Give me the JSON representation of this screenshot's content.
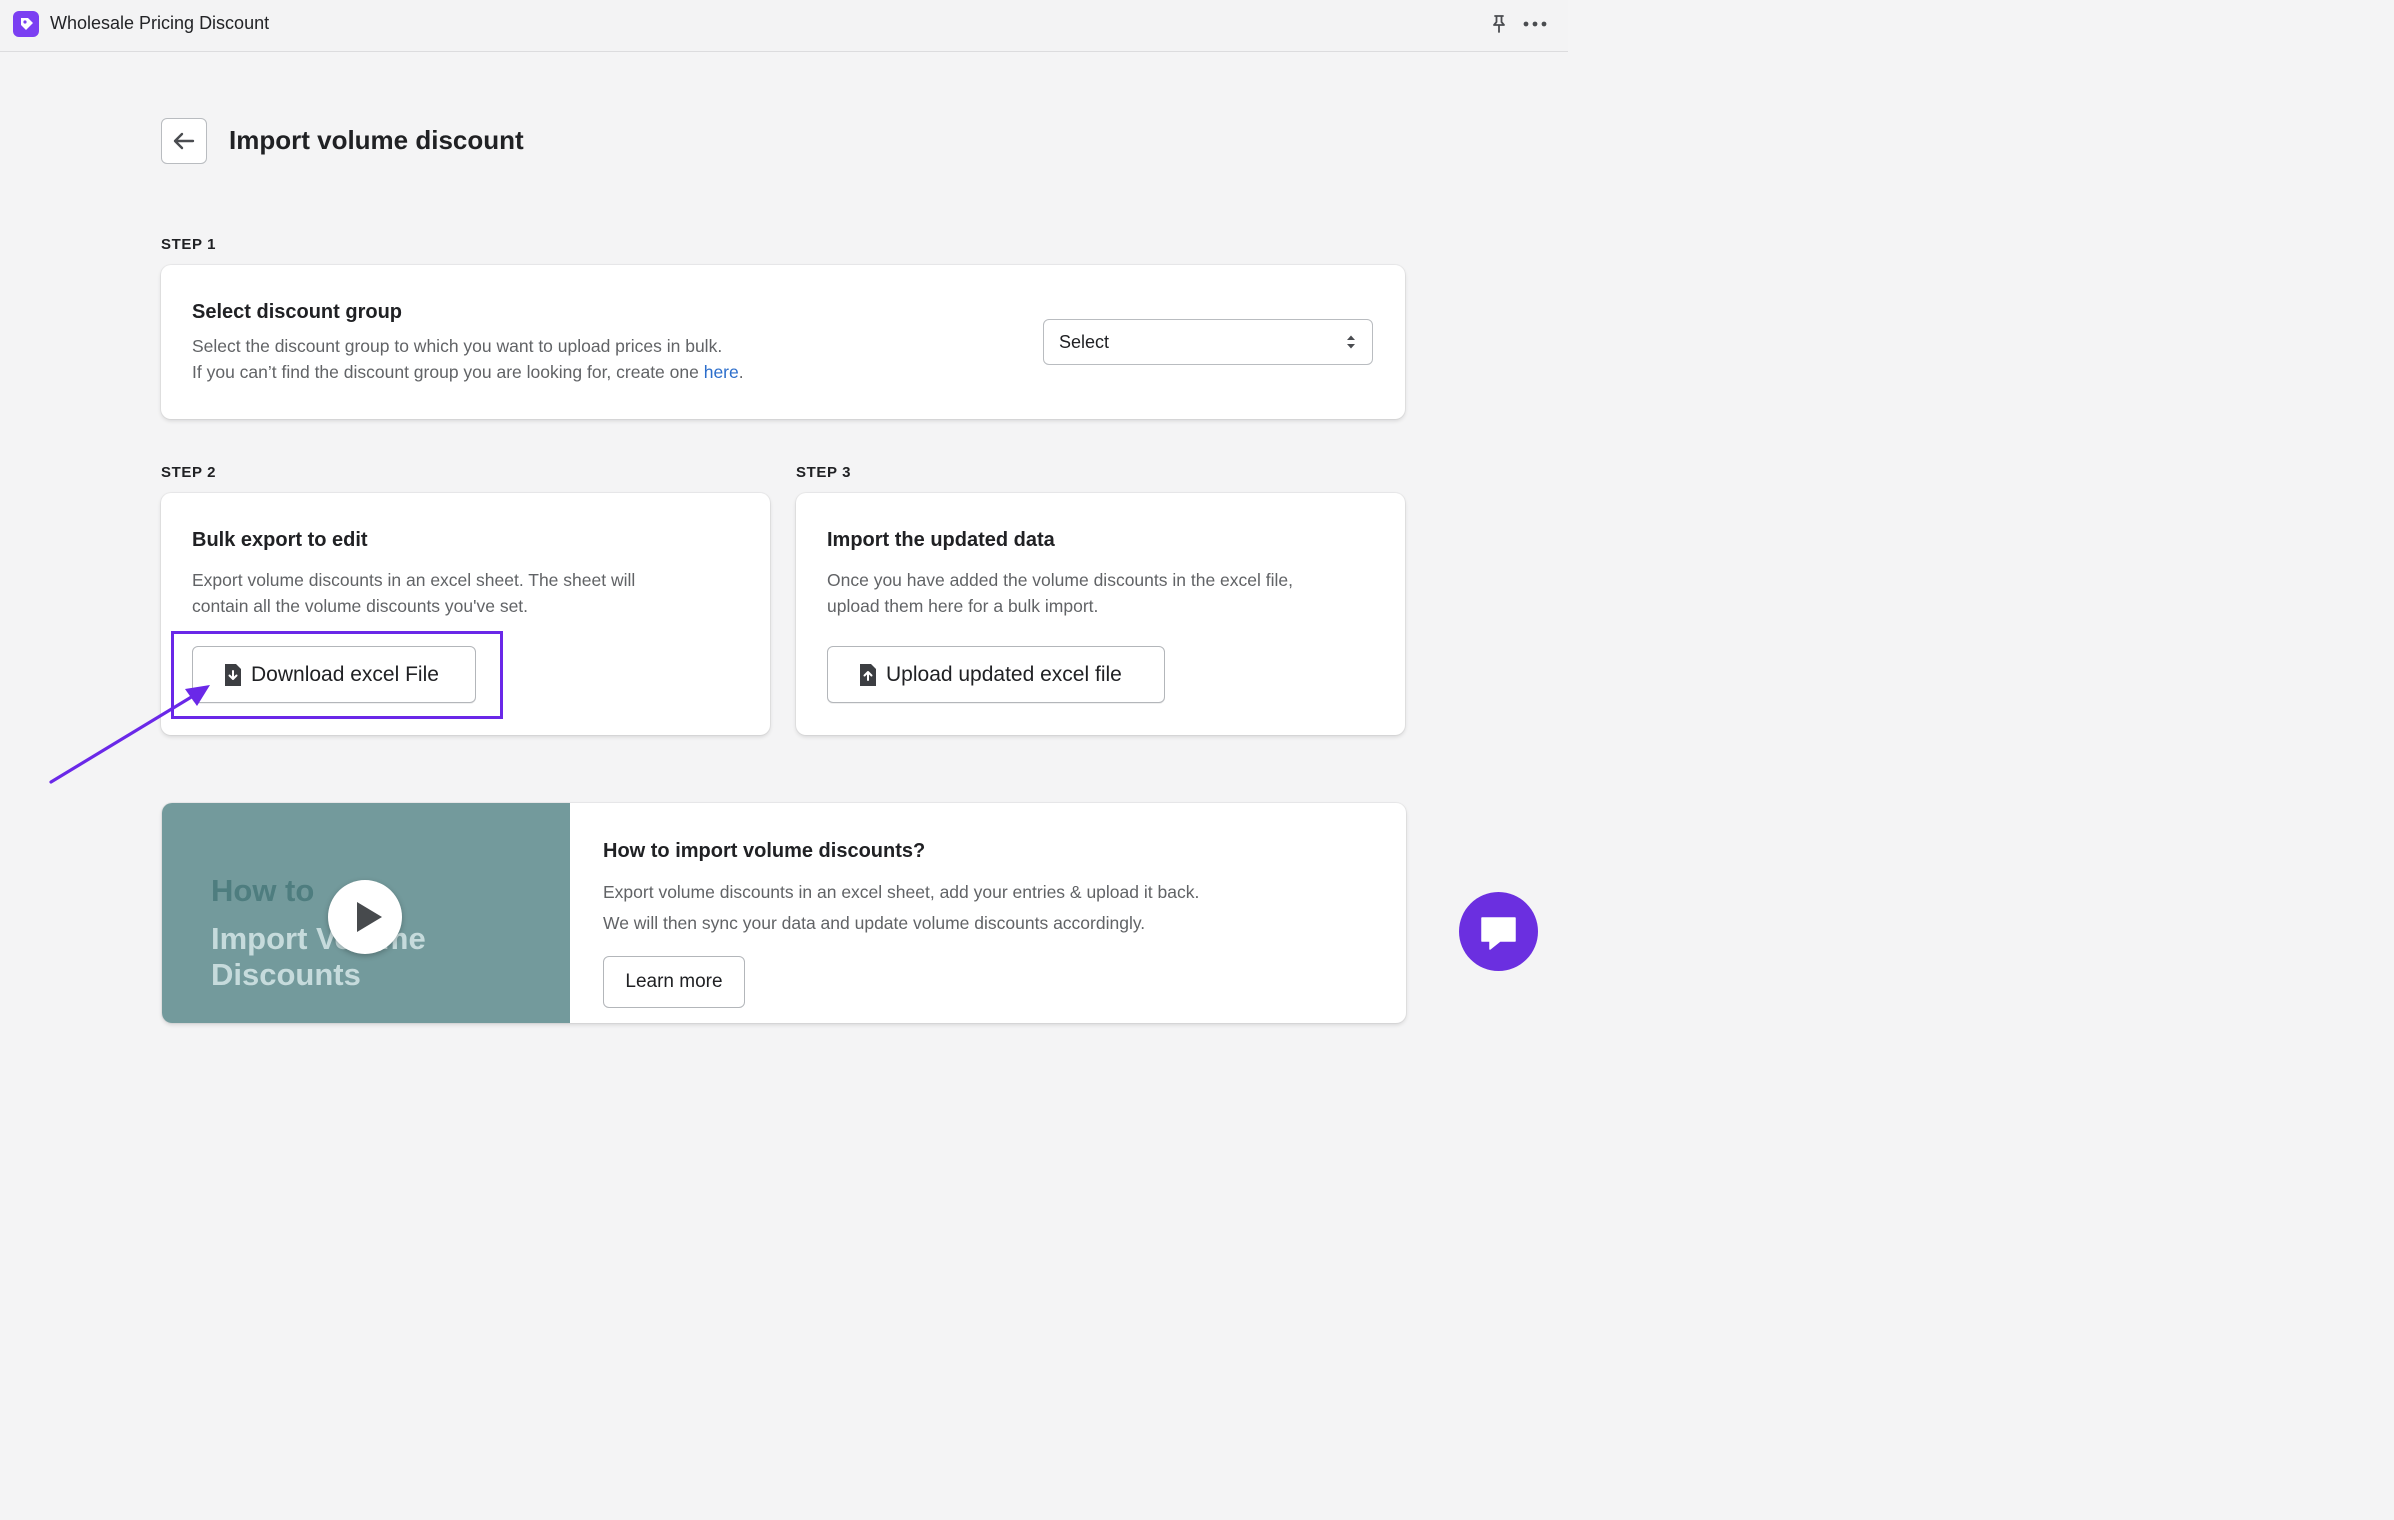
{
  "app": {
    "title": "Wholesale Pricing Discount"
  },
  "page": {
    "title": "Import volume discount"
  },
  "step1": {
    "label": "STEP 1",
    "heading": "Select discount group",
    "desc_line1": "Select the discount group to which you want to upload prices in bulk.",
    "desc_line2_prefix": "If you can’t find the discount group you are looking for, create one ",
    "link_text": "here",
    "desc_line2_suffix": ".",
    "select_value": "Select"
  },
  "step2": {
    "label": "STEP 2",
    "heading": "Bulk export to edit",
    "desc_line1": "Export volume discounts in an excel sheet. The sheet will",
    "desc_line2": "contain all the volume discounts you've set.",
    "button_label": "Download excel File"
  },
  "step3": {
    "label": "STEP 3",
    "heading": "Import the updated data",
    "desc_line1": "Once you have added the volume discounts in the excel file,",
    "desc_line2": "upload them here for a bulk import.",
    "button_label": "Upload updated excel file"
  },
  "video": {
    "thumb_line1": "How to",
    "thumb_line2": "Import Volume",
    "thumb_line3": "Discounts",
    "heading": "How to import volume discounts?",
    "desc_line1": "Export volume discounts in an excel sheet, add your entries & upload it back.",
    "desc_line2": "We will then sync your data and update volume discounts accordingly.",
    "button_label": "Learn more"
  },
  "colors": {
    "accent": "#6a28e8",
    "chat": "#6b2fe0",
    "link": "#2c6ecb",
    "thumb_bg": "#739a9c"
  },
  "icons": {
    "app_logo": "tag-icon",
    "pin": "pin-icon",
    "more": "more-horizontal-icon",
    "back": "arrow-left-icon",
    "select": "select-arrows-icon",
    "download": "file-download-icon",
    "upload": "file-upload-icon",
    "play": "play-icon",
    "chat": "chat-icon"
  }
}
